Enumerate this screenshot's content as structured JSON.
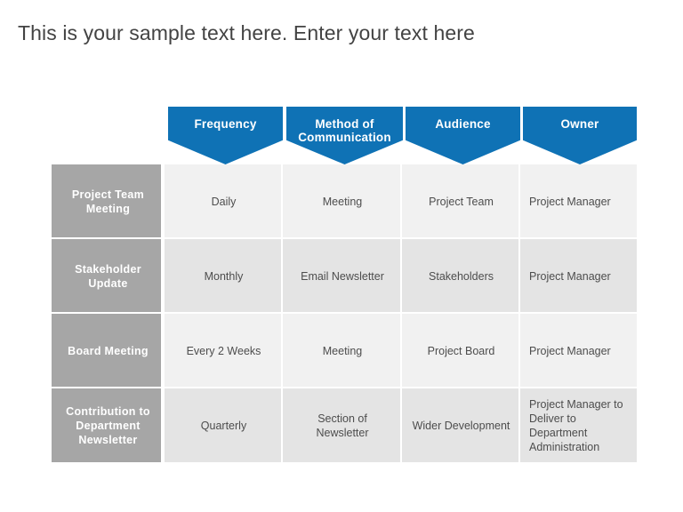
{
  "title": "This is your sample text here. Enter your text here",
  "theme": {
    "accent_blue": "#0f72b5",
    "label_gray": "#a6a6a6",
    "row_light": "#f1f1f1",
    "row_dark": "#e4e4e4",
    "title_color": "#434343",
    "cell_text": "#4d4d4d",
    "background": "#ffffff"
  },
  "table": {
    "headers": [
      "Frequency",
      "Method of\nCommunication",
      "Audience",
      "Owner"
    ],
    "headers_display": [
      "Frequency",
      "Method of Communication",
      "Audience",
      "Owner"
    ],
    "header_line1": [
      "Frequency",
      "Method of",
      "Audience",
      "Owner"
    ],
    "header_line2": [
      "",
      "Communication",
      "",
      ""
    ],
    "rows": [
      {
        "label": "Project Team Meeting",
        "label_line1": "Project Team",
        "label_line2": "Meeting",
        "cells": [
          "Daily",
          "Meeting",
          "Project Team",
          "Project Manager"
        ]
      },
      {
        "label": "Stakeholder Update",
        "label_line1": "Stakeholder",
        "label_line2": "Update",
        "cells": [
          "Monthly",
          "Email Newsletter",
          "Stakeholders",
          "Project Manager"
        ]
      },
      {
        "label": "Board Meeting",
        "label_line1": "Board Meeting",
        "label_line2": "",
        "cells": [
          "Every 2 Weeks",
          "Meeting",
          "Project Board",
          "Project Manager"
        ]
      },
      {
        "label": "Contribution to Department Newsletter",
        "label_line1": "Contribution  to",
        "label_line2": "Department",
        "label_line3": "Newsletter",
        "cells": [
          "Quarterly",
          "Section of Newsletter",
          "Wider Development",
          "Project Manager to Deliver to Department Administration"
        ]
      }
    ]
  }
}
